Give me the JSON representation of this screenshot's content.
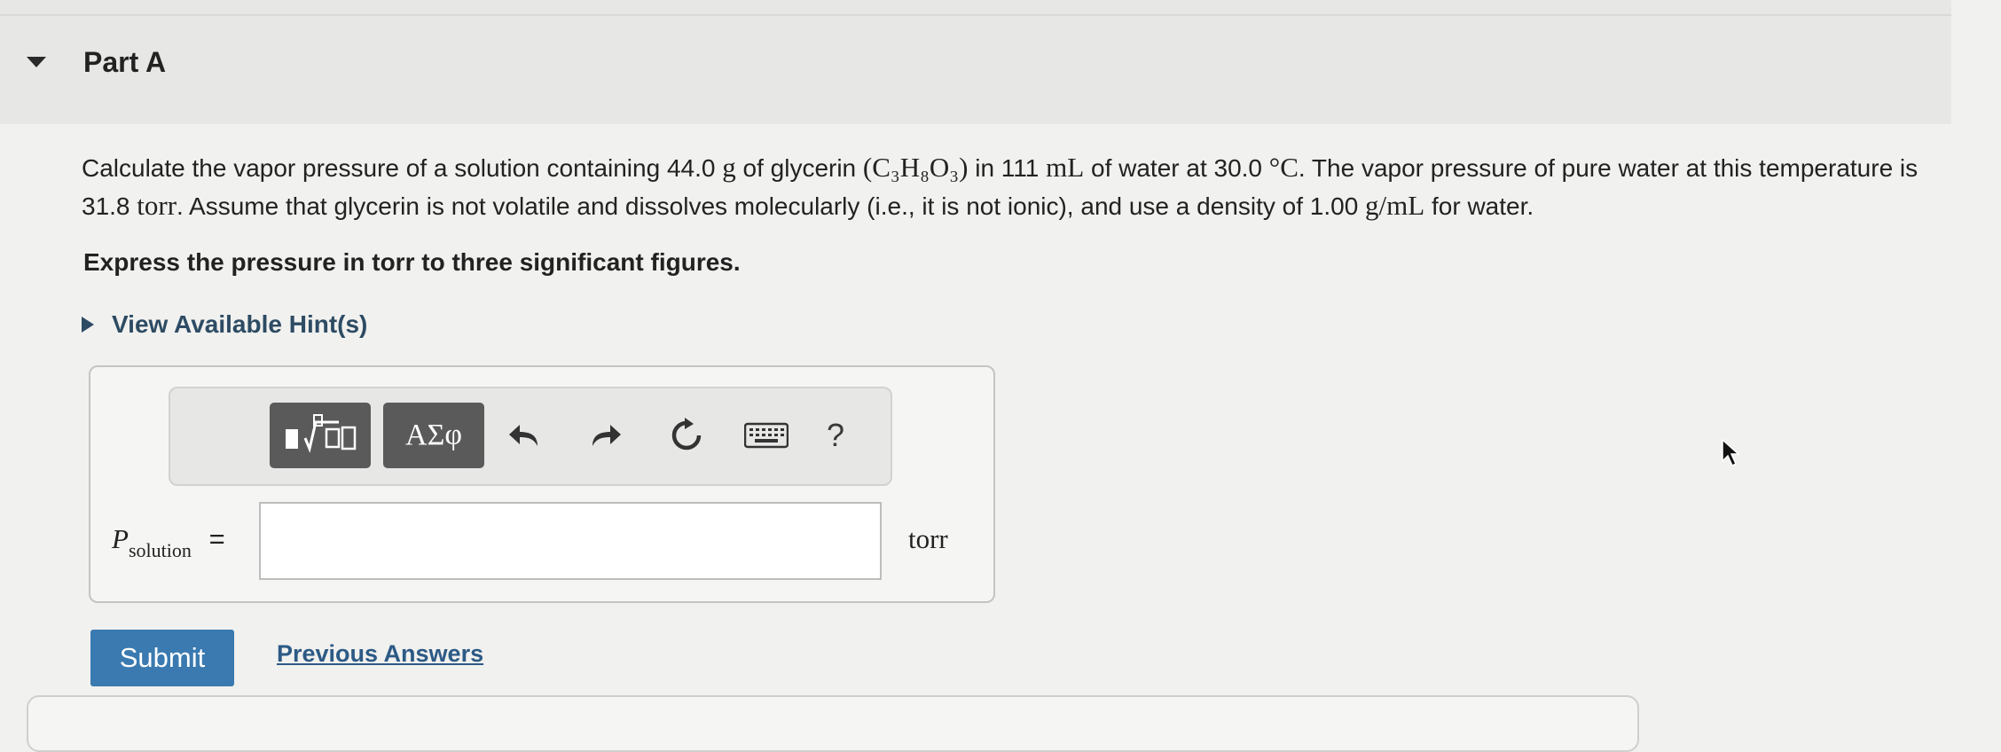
{
  "part": {
    "title": "Part A"
  },
  "question": {
    "text_1": "Calculate the vapor pressure of a solution containing 44.0",
    "mass_unit": "g",
    "text_2": "of glycerin",
    "formula": "(C₃H₈O₃)",
    "text_3": "in 111",
    "volume_unit": "mL",
    "text_4": "of water at 30.0",
    "temp_unit": "°C",
    "text_5": ". The vapor pressure of pure water at this temperature is 31.8",
    "pressure_unit": "torr",
    "text_6": ". Assume that glycerin is not volatile and dissolves molecularly (i.e., it is not ionic), and use a density of 1.00",
    "density_unit": "g/mL",
    "text_7": "for water."
  },
  "instruction": "Express the pressure in torr to three significant figures.",
  "hint": {
    "label": "View Available Hint(s)"
  },
  "toolbar": {
    "templates_icon": "fraction-sqrt-icon",
    "greek_label": "ΑΣφ",
    "undo_icon": "undo-icon",
    "redo_icon": "redo-icon",
    "reset_icon": "reset-icon",
    "keyboard_icon": "keyboard-icon",
    "help_label": "?"
  },
  "answer": {
    "variable": "P",
    "subscript": "solution",
    "equals": "=",
    "value": "",
    "unit": "torr"
  },
  "actions": {
    "submit_label": "Submit",
    "previous_answers_label": "Previous Answers"
  },
  "colors": {
    "submit_bg": "#3a7ab0",
    "link": "#2d5a86",
    "hint": "#2d4b63"
  }
}
